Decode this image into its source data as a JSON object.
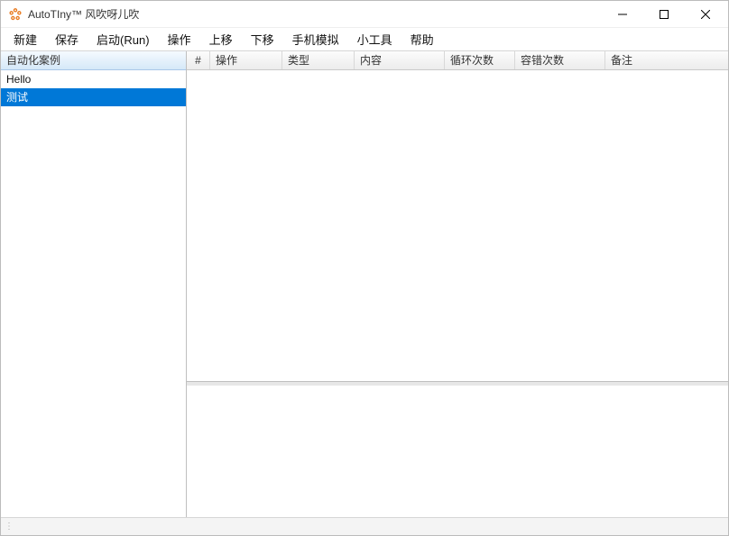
{
  "window": {
    "title": "AutoTIny™ 风吹呀儿吹"
  },
  "menu": {
    "items": [
      "新建",
      "保存",
      "启动(Run)",
      "操作",
      "上移",
      "下移",
      "手机模拟",
      "小工具",
      "帮助"
    ]
  },
  "sidebar": {
    "header": "自动化案例",
    "items": [
      {
        "label": "Hello",
        "selected": false
      },
      {
        "label": "测试",
        "selected": true
      }
    ]
  },
  "table": {
    "columns": {
      "idx": "#",
      "op": "操作",
      "type": "类型",
      "content": "内容",
      "loop": "循环次数",
      "tolerance": "容错次数",
      "note": "备注"
    },
    "rows": []
  },
  "statusbar": {
    "text": ""
  }
}
